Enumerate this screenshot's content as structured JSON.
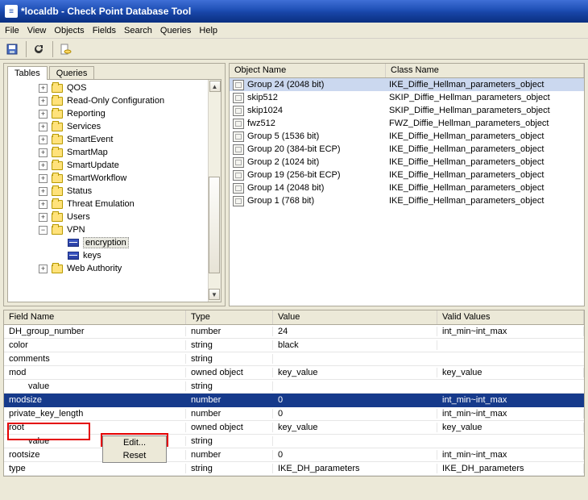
{
  "window": {
    "title": "*localdb - Check Point Database Tool"
  },
  "menu": [
    "File",
    "View",
    "Objects",
    "Fields",
    "Search",
    "Queries",
    "Help"
  ],
  "tabs": {
    "tables": "Tables",
    "queries": "Queries"
  },
  "tree": [
    {
      "indent": 1,
      "exp": "+",
      "icon": "folder",
      "label": "QOS"
    },
    {
      "indent": 1,
      "exp": "+",
      "icon": "folder",
      "label": "Read-Only Configuration"
    },
    {
      "indent": 1,
      "exp": "+",
      "icon": "folder",
      "label": "Reporting"
    },
    {
      "indent": 1,
      "exp": "+",
      "icon": "folder",
      "label": "Services"
    },
    {
      "indent": 1,
      "exp": "+",
      "icon": "folder",
      "label": "SmartEvent"
    },
    {
      "indent": 1,
      "exp": "+",
      "icon": "folder",
      "label": "SmartMap"
    },
    {
      "indent": 1,
      "exp": "+",
      "icon": "folder",
      "label": "SmartUpdate"
    },
    {
      "indent": 1,
      "exp": "+",
      "icon": "folder",
      "label": "SmartWorkflow"
    },
    {
      "indent": 1,
      "exp": "+",
      "icon": "folder",
      "label": "Status"
    },
    {
      "indent": 1,
      "exp": "+",
      "icon": "folder",
      "label": "Threat Emulation"
    },
    {
      "indent": 1,
      "exp": "+",
      "icon": "folder",
      "label": "Users"
    },
    {
      "indent": 1,
      "exp": "−",
      "icon": "folder",
      "label": "VPN"
    },
    {
      "indent": 2,
      "exp": "",
      "icon": "key",
      "label": "encryption",
      "selected": true
    },
    {
      "indent": 2,
      "exp": "",
      "icon": "key",
      "label": "keys"
    },
    {
      "indent": 1,
      "exp": "+",
      "icon": "folder",
      "label": "Web Authority"
    }
  ],
  "list": {
    "headers": {
      "object": "Object Name",
      "class": "Class Name"
    },
    "rows": [
      {
        "name": "Group 24 (2048 bit)",
        "cls": "IKE_Diffie_Hellman_parameters_object",
        "selected": true
      },
      {
        "name": "skip512",
        "cls": "SKIP_Diffie_Hellman_parameters_object"
      },
      {
        "name": "skip1024",
        "cls": "SKIP_Diffie_Hellman_parameters_object"
      },
      {
        "name": "fwz512",
        "cls": "FWZ_Diffie_Hellman_parameters_object"
      },
      {
        "name": "Group 5 (1536 bit)",
        "cls": "IKE_Diffie_Hellman_parameters_object"
      },
      {
        "name": "Group 20 (384-bit ECP)",
        "cls": "IKE_Diffie_Hellman_parameters_object"
      },
      {
        "name": "Group 2 (1024 bit)",
        "cls": "IKE_Diffie_Hellman_parameters_object"
      },
      {
        "name": "Group 19 (256-bit ECP)",
        "cls": "IKE_Diffie_Hellman_parameters_object"
      },
      {
        "name": "Group 14 (2048 bit)",
        "cls": "IKE_Diffie_Hellman_parameters_object"
      },
      {
        "name": "Group 1 (768 bit)",
        "cls": "IKE_Diffie_Hellman_parameters_object"
      }
    ]
  },
  "grid": {
    "headers": {
      "field": "Field Name",
      "type": "Type",
      "value": "Value",
      "valid": "Valid Values"
    },
    "rows": [
      {
        "field": "DH_group_number",
        "indent": 0,
        "type": "number",
        "value": "24",
        "valid": "int_min~int_max"
      },
      {
        "field": "color",
        "indent": 0,
        "type": "string",
        "value": "black",
        "valid": ""
      },
      {
        "field": "comments",
        "indent": 0,
        "type": "string",
        "value": "",
        "valid": ""
      },
      {
        "field": "mod",
        "indent": 0,
        "type": "owned object",
        "value": "key_value",
        "valid": "key_value"
      },
      {
        "field": "value",
        "indent": 1,
        "type": "string",
        "value": "",
        "valid": ""
      },
      {
        "field": "modsize",
        "indent": 0,
        "type": "number",
        "value": "0",
        "valid": "int_min~int_max",
        "selected": true
      },
      {
        "field": "private_key_length",
        "indent": 0,
        "type": "number",
        "value": "0",
        "valid": "int_min~int_max"
      },
      {
        "field": "root",
        "indent": 0,
        "type": "owned object",
        "value": "key_value",
        "valid": "key_value"
      },
      {
        "field": "value",
        "indent": 1,
        "type": "string",
        "value": "",
        "valid": ""
      },
      {
        "field": "rootsize",
        "indent": 0,
        "type": "number",
        "value": "0",
        "valid": "int_min~int_max"
      },
      {
        "field": "type",
        "indent": 0,
        "type": "string",
        "value": "IKE_DH_parameters",
        "valid": "IKE_DH_parameters"
      }
    ]
  },
  "ctx": {
    "edit": "Edit...",
    "reset": "Reset"
  }
}
